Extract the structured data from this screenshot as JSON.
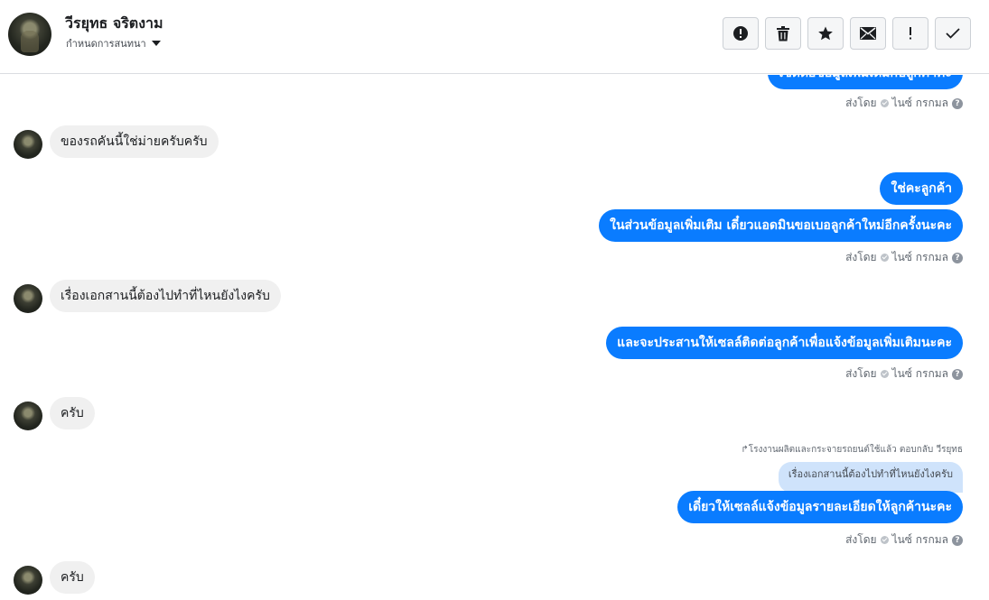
{
  "header": {
    "name": "วีรยุทธ จริตงาม",
    "subtitle": "กำหนดการสนทนา",
    "actions": [
      {
        "name": "report-button",
        "icon": "alert-circle-icon"
      },
      {
        "name": "delete-button",
        "icon": "trash-icon"
      },
      {
        "name": "star-button",
        "icon": "star-icon"
      },
      {
        "name": "mark-unread-button",
        "icon": "envelope-icon"
      },
      {
        "name": "priority-button",
        "icon": "exclamation-icon"
      },
      {
        "name": "done-button",
        "icon": "checkmark-icon"
      }
    ]
  },
  "messages": {
    "out_0": "เซ็ดต่อข้อมูลเพิ่มเติมกับลูกค้าค่ะ",
    "sent_by_label": "ส่งโดย",
    "sent_by_name": "ไนซ์ กรกมล",
    "in_1": "ของรถคันนี้ใช่ม่ายครับครับ",
    "out_1a": "ใช่คะลูกค้า",
    "out_1b": "ในส่วนข้อมูลเพิ่มเติม เดี๋ยวแอดมินขอเบอลูกค้าใหม่อีกครั้งนะคะ",
    "in_2": "เรื่องเอกสานนี้ต้องไปทำที่ไหนยังไงครับ",
    "out_2": "และจะประสานให้เซลล์ติดต่อลูกค้าเพื่อแจ้งข้อมูลเพิ่มเติมนะคะ",
    "in_3": "ครับ",
    "reply_meta": "โรงงานผลิตและกระจายรถยนต์ใช้แล้ว ตอบกลับ วีรยุทธ",
    "reply_quote": "เรื่องเอกสานนี้ต้องไปทำที่ไหนยังไงครับ",
    "out_3": "เดี๋ยวให้เซลล์แจ้งข้อมูลรายละเอียดให้ลูกค้านะคะ",
    "in_4": "ครับ"
  },
  "colors": {
    "outgoing_bubble": "#0a7cff",
    "incoming_bubble": "#f0f0f0",
    "reply_quote": "#cfe3fb"
  }
}
